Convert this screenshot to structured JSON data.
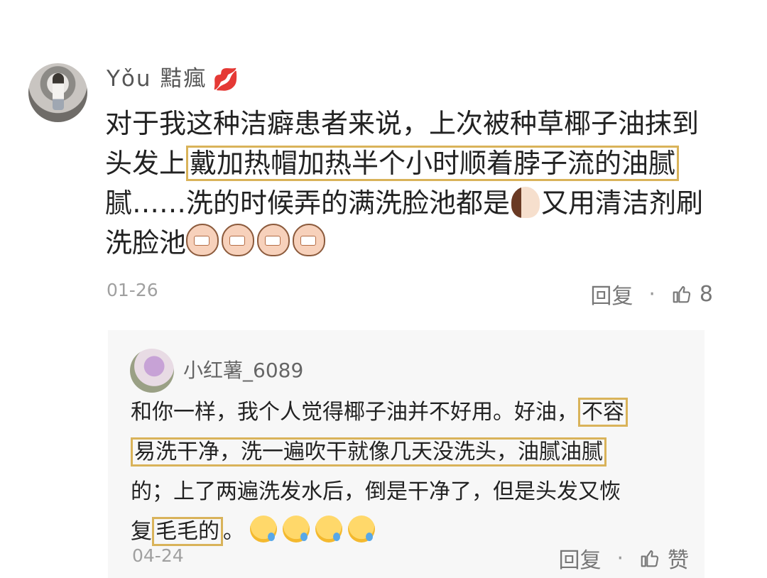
{
  "comment": {
    "username": "Yǒu 黠瘋",
    "text_lines": [
      "对于我这种洁癖患者来说，上次被种草椰子油抹到",
      "头发上",
      "戴加热帽加热半个小时顺着脖子流的油腻",
      "腻……洗的时候弄的满洗脸池都是",
      "又用清洁剂刷",
      "洗脸池"
    ],
    "date": "01-26",
    "reply_label": "回复",
    "dot": "·",
    "like_count": "8"
  },
  "reply": {
    "username": "小红薯_6089",
    "segments": [
      "和你一样，我个人觉得椰子油并不好用。好油，",
      "不容",
      "易洗干净，洗一遍吹干就像几天没洗头，油腻油腻",
      "的；上了两遍洗发水后，倒是干净了，但是头发又恢",
      "复",
      "毛毛的",
      "。"
    ],
    "date": "04-24",
    "reply_label": "回复",
    "dot": "·",
    "like_label": "赞"
  }
}
